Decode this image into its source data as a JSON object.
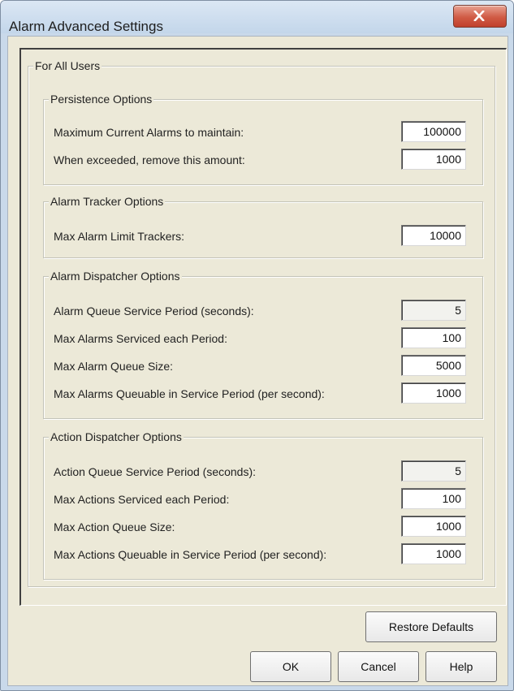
{
  "window": {
    "title": "Alarm Advanced Settings"
  },
  "main": {
    "group_title": "For All Users"
  },
  "persistence": {
    "title": "Persistence Options",
    "rows": [
      {
        "label": "Maximum Current Alarms to maintain:",
        "value": "100000"
      },
      {
        "label": "When exceeded, remove this amount:",
        "value": "1000"
      }
    ]
  },
  "tracker": {
    "title": "Alarm Tracker Options",
    "rows": [
      {
        "label": "Max Alarm Limit Trackers:",
        "value": "10000"
      }
    ]
  },
  "alarm_dispatcher": {
    "title": "Alarm Dispatcher Options",
    "rows": [
      {
        "label": "Alarm Queue Service Period (seconds):",
        "value": "5"
      },
      {
        "label": "Max Alarms Serviced each Period:",
        "value": "100"
      },
      {
        "label": "Max Alarm Queue Size:",
        "value": "5000"
      },
      {
        "label": "Max Alarms Queuable in Service Period (per second):",
        "value": "1000"
      }
    ]
  },
  "action_dispatcher": {
    "title": "Action Dispatcher Options",
    "rows": [
      {
        "label": "Action Queue Service Period (seconds):",
        "value": "5"
      },
      {
        "label": "Max Actions Serviced each Period:",
        "value": "100"
      },
      {
        "label": "Max Action Queue Size:",
        "value": "1000"
      },
      {
        "label": "Max Actions Queuable in Service Period (per second):",
        "value": "1000"
      }
    ]
  },
  "buttons": {
    "restore": "Restore Defaults",
    "ok": "OK",
    "cancel": "Cancel",
    "help": "Help"
  },
  "icons": {
    "close": "close-icon"
  }
}
